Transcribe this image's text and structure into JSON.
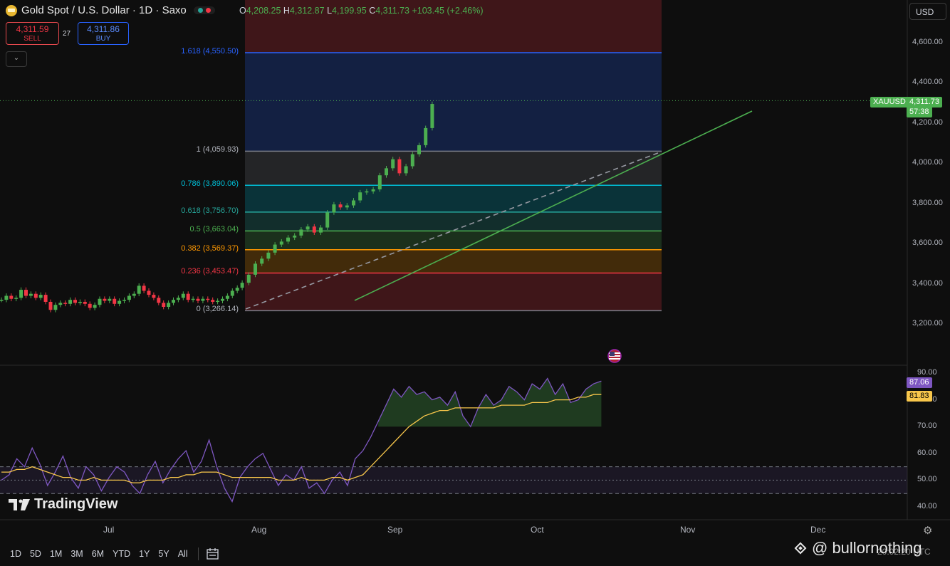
{
  "header": {
    "title": "Gold Spot / U.S. Dollar · 1D · Saxo",
    "ohlc": {
      "open_label": "O",
      "open": "4,208.25",
      "high_label": "H",
      "high": "4,312.87",
      "low_label": "L",
      "low": "4,199.95",
      "close_label": "C",
      "close": "4,311.73",
      "change": "+103.45 (+2.46%)"
    },
    "sell_price": "4,311.59",
    "sell_label": "SELL",
    "spread": "27",
    "buy_price": "4,311.86",
    "buy_label": "BUY",
    "collapse_icon": "chevron-down-icon"
  },
  "currency_select": "USD",
  "price_axis": [
    "4,600.00",
    "4,400.00",
    "4,200.00",
    "4,000.00",
    "3,800.00",
    "3,600.00",
    "3,400.00",
    "3,200.00"
  ],
  "symbol_tag": {
    "symbol": "XAUUSD",
    "price": "4,311.73",
    "countdown": "57:38",
    "color": "#4caf50"
  },
  "fib_levels": [
    {
      "label": "1.618 (4,550.50)",
      "price": 4550.5,
      "color": "#2962ff"
    },
    {
      "label": "1 (4,059.93)",
      "price": 4059.93,
      "color": "#787b86"
    },
    {
      "label": "0.786 (3,890.06)",
      "price": 3890.06,
      "color": "#00bcd4"
    },
    {
      "label": "0.618 (3,756.70)",
      "price": 3756.7,
      "color": "#26a69a"
    },
    {
      "label": "0.5 (3,663.04)",
      "price": 3663.04,
      "color": "#4caf50"
    },
    {
      "label": "0.382 (3,569.37)",
      "price": 3569.37,
      "color": "#ff9800"
    },
    {
      "label": "0.236 (3,453.47)",
      "price": 3453.47,
      "color": "#f23645"
    },
    {
      "label": "0 (3,266.14)",
      "price": 3266.14,
      "color": "#787b86"
    }
  ],
  "rsi_axis": [
    "90.00",
    "80.00",
    "70.00",
    "60.00",
    "50.00",
    "40.00"
  ],
  "rsi_tags": {
    "rsi": "87.06",
    "rsi_color": "#7e57c2",
    "ma": "81.83",
    "ma_color": "#f7c64b"
  },
  "time_axis": [
    "Jul",
    "Aug",
    "Sep",
    "Oct",
    "Nov",
    "Dec"
  ],
  "ranges": [
    "1D",
    "5D",
    "1M",
    "3M",
    "6M",
    "YTD",
    "1Y",
    "5Y",
    "All"
  ],
  "branding": {
    "logo_text": "TradingView",
    "watermark": "@ bullornothing",
    "time_partial": "20:02:20 UTC"
  },
  "icons": {
    "settings": "gear-icon",
    "compare": "calendar-range-icon",
    "flag": "us-flag-icon"
  }
}
